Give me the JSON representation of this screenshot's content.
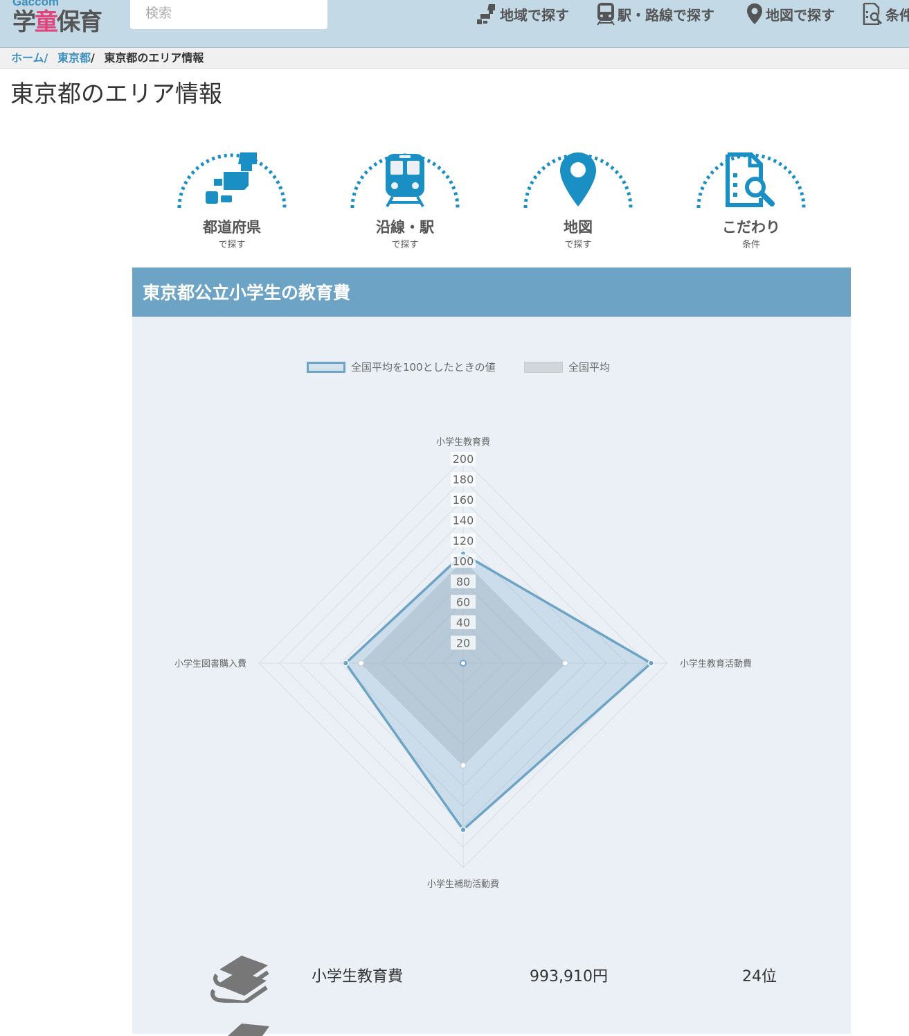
{
  "header": {
    "logo_top": "Gaccom",
    "logo_main_a": "学",
    "logo_main_b": "童",
    "logo_main_c": "保育",
    "search_placeholder": "検索",
    "nav": [
      {
        "label": "地域で探す",
        "icon": "japan-map-icon"
      },
      {
        "label": "駅・路線で探す",
        "icon": "train-icon"
      },
      {
        "label": "地図で探す",
        "icon": "map-pin-icon"
      },
      {
        "label": "条件",
        "icon": "document-search-icon"
      }
    ]
  },
  "breadcrumb": {
    "items": [
      "ホーム",
      "東京都"
    ],
    "current": "東京都のエリア情報",
    "separator": "/"
  },
  "page_title": "東京都のエリア情報",
  "categories": [
    {
      "label": "都道府県",
      "sub": "で探す",
      "icon": "japan-map-icon"
    },
    {
      "label": "沿線・駅",
      "sub": "で探す",
      "icon": "train-icon"
    },
    {
      "label": "地図",
      "sub": "で探す",
      "icon": "map-pin-icon"
    },
    {
      "label": "こだわり",
      "sub": "条件",
      "icon": "document-search-icon"
    }
  ],
  "panel": {
    "title": "東京都公立小学生の教育費"
  },
  "chart_data": {
    "type": "radar",
    "axes": [
      "小学生教育費",
      "小学生教育活動費",
      "小学生補助活動費",
      "小学生図書購入費"
    ],
    "ticks": [
      20,
      40,
      60,
      80,
      100,
      120,
      140,
      160,
      180,
      200
    ],
    "rlim": [
      0,
      200
    ],
    "series": [
      {
        "name": "全国平均を100としたときの値",
        "values": [
          107,
          184,
          163,
          115
        ],
        "color": "#6da3c5"
      },
      {
        "name": "全国平均",
        "values": [
          100,
          100,
          100,
          100
        ],
        "color": "#c8cdd2"
      }
    ],
    "legend": "top-center"
  },
  "stats": [
    {
      "label": "小学生教育費",
      "value": "993,910円",
      "rank": "24位",
      "icon": "books-icon"
    }
  ],
  "colors": {
    "accent": "#1a8fc4",
    "header_bg": "#c3d9e6",
    "panel_head": "#6da3c5",
    "panel_bg": "#ebf0f7"
  }
}
